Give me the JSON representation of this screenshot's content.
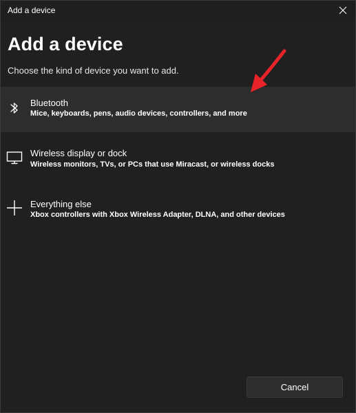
{
  "window": {
    "title": "Add a device"
  },
  "header": {
    "heading": "Add a device",
    "subheading": "Choose the kind of device you want to add."
  },
  "options": [
    {
      "name": "Bluetooth",
      "description": "Mice, keyboards, pens, audio devices, controllers, and more",
      "icon": "bluetooth-icon"
    },
    {
      "name": "Wireless display or dock",
      "description": "Wireless monitors, TVs, or PCs that use Miracast, or wireless docks",
      "icon": "monitor-icon"
    },
    {
      "name": "Everything else",
      "description": "Xbox controllers with Xbox Wireless Adapter, DLNA, and other devices",
      "icon": "plus-icon"
    }
  ],
  "footer": {
    "cancel_label": "Cancel"
  },
  "colors": {
    "background": "#202020",
    "selected_row": "#2d2d2d",
    "annotation_arrow": "#e8242a"
  }
}
